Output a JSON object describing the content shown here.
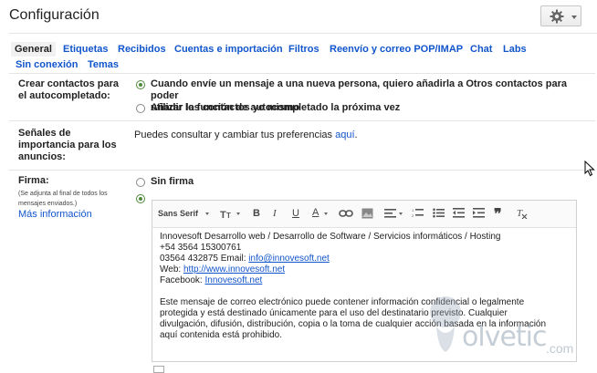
{
  "page": {
    "title": "Configuración"
  },
  "tabs": [
    {
      "label": "General",
      "active": true
    },
    {
      "label": "Etiquetas"
    },
    {
      "label": "Recibidos"
    },
    {
      "label": "Cuentas e importación"
    },
    {
      "label": "Filtros"
    },
    {
      "label": "Reenvío y correo POP/IMAP"
    },
    {
      "label": "Chat"
    },
    {
      "label": "Labs"
    },
    {
      "label": "Sin conexión"
    },
    {
      "label": "Temas"
    }
  ],
  "autocomplete": {
    "label_line1": "Crear contactos para",
    "label_line2": "el autocompletado:",
    "option1_line1": "Cuando envíe un mensaje a una nueva persona, quiero añadirla a Otros contactos para poder",
    "option1_line2": "utilizar la función de autocompletado la próxima vez",
    "option2": "Añadir los contactos yo mismo",
    "selected": "option1"
  },
  "importance": {
    "label_line1": "Señales de",
    "label_line2": "importancia para los",
    "label_line3": "anuncios:",
    "text": "Puedes consultar y cambiar tus preferencias",
    "link": "aquí",
    "period": "."
  },
  "signature": {
    "label": "Firma:",
    "note_line1": "(Se adjunta al final de todos los",
    "note_line2": "mensajes enviados.)",
    "more_info": "Más información",
    "no_signature": "Sin firma",
    "selected": "custom",
    "toolbar": {
      "font": "Sans Serif"
    },
    "body": {
      "line1": "Innovesoft Desarrollo web / Desarrollo de Software / Servicios informáticos / Hosting",
      "line2": "+54 3564 15300761",
      "line3_prefix": "03564 432875 Email: ",
      "line3_link": "info@innovesoft.net",
      "line4_prefix": "Web: ",
      "line4_link": "http://www.innovesoft.net",
      "line5_prefix": "Facebook: ",
      "line5_link": "Innovesoft.net",
      "disclaimer1": "Este mensaje de correo electrónico puede contener información confidencial o legalmente",
      "disclaimer2": "protegida y está destinado únicamente para el uso del destinatario previsto. Cualquier",
      "disclaimer3": "divulgación, difusión, distribución, copia o la toma de cualquier acción basada en la información",
      "disclaimer4": "aquí contenida está prohibido."
    }
  },
  "watermark": {
    "text": "olvetic",
    "suffix": ".com"
  }
}
